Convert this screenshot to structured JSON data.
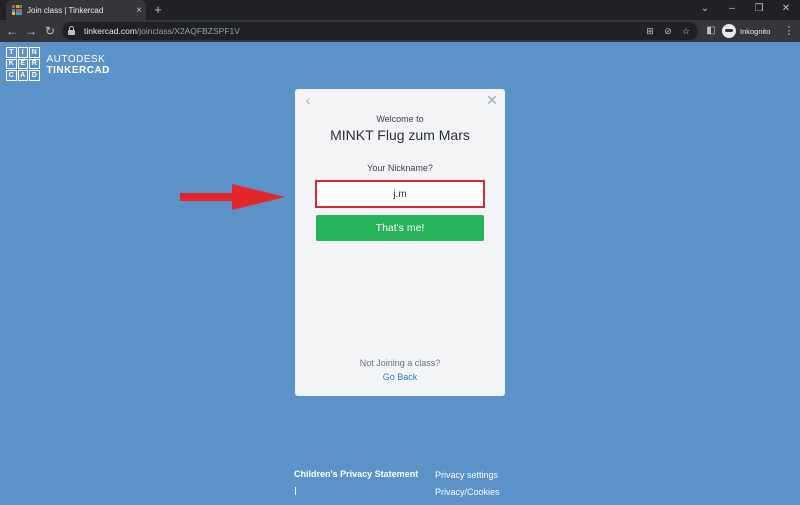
{
  "browser": {
    "tab_title": "Join class | Tinkercad",
    "tab_close": "×",
    "new_tab": "+",
    "url_host": "tinkercad.com",
    "url_path": "/joinclass/X2AQFBZSPF1V",
    "profile_label": "Inkognito",
    "icons": [
      "back-icon",
      "forward-icon",
      "reload-icon",
      "lock-icon",
      "translate-icon",
      "eye-off-icon",
      "star-icon",
      "sidepanel-icon",
      "incognito-icon",
      "menu-icon"
    ]
  },
  "logo": {
    "letters": [
      "T",
      "I",
      "N",
      "K",
      "E",
      "R",
      "C",
      "A",
      "D"
    ],
    "brand": "AUTODESK",
    "product": "TINKERCAD"
  },
  "dialog": {
    "welcome": "Welcome to",
    "class_name": "MINKT Flug zum Mars",
    "nickname_label": "Your Nickname?",
    "nickname_value": "j.m",
    "submit_label": "That's me!",
    "not_joining": "Not Joining a class?",
    "go_back": "Go Back"
  },
  "footer": {
    "childrens_privacy": "Children's Privacy Statement",
    "privacy_settings": "Privacy settings",
    "privacy_cookies": "Privacy/Cookies"
  },
  "colors": {
    "page_background": "#5b92c8",
    "button_green": "#28b35b",
    "input_highlight": "#d9282f",
    "annotation_arrow": "#e3262a",
    "link_blue": "#2e7cbd"
  }
}
